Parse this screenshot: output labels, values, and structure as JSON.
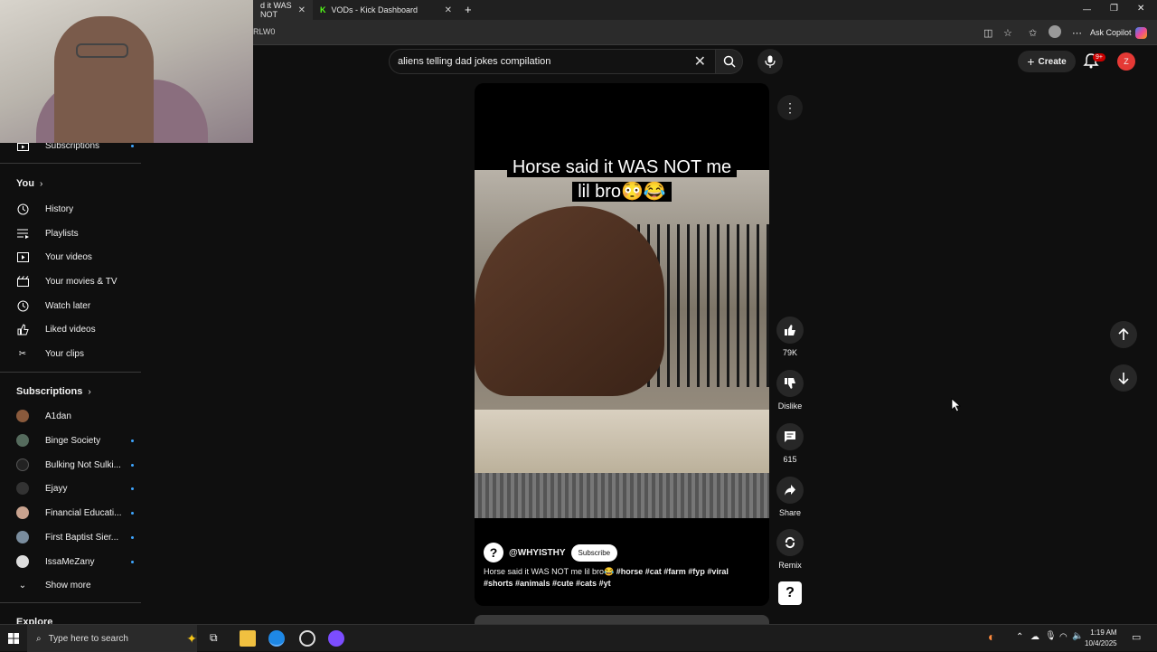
{
  "browser": {
    "tabs": [
      {
        "label": "d it WAS NOT",
        "close": "✕"
      },
      {
        "label": "VODs - Kick Dashboard",
        "close": "✕"
      }
    ],
    "new_tab": "+",
    "address_fragment": "RLW0",
    "ask_copilot": "Ask Copilot",
    "window_controls": [
      "—",
      "❐",
      "✕"
    ]
  },
  "header": {
    "search_value": "aliens telling dad jokes compilation",
    "create_label": "Create",
    "notif_badge": "9+",
    "avatar_letter": "Z"
  },
  "sidebar": {
    "top_item": "Subscriptions",
    "you_label": "You",
    "you_items": [
      {
        "label": "History",
        "icon": "history-icon"
      },
      {
        "label": "Playlists",
        "icon": "playlists-icon"
      },
      {
        "label": "Your videos",
        "icon": "your-videos-icon"
      },
      {
        "label": "Your movies & TV",
        "icon": "movies-icon"
      },
      {
        "label": "Watch later",
        "icon": "watch-later-icon"
      },
      {
        "label": "Liked videos",
        "icon": "liked-icon"
      },
      {
        "label": "Your clips",
        "icon": "clips-icon"
      }
    ],
    "subs_label": "Subscriptions",
    "channels": [
      {
        "label": "A1dan",
        "color": "#8a5a3c",
        "dot": false
      },
      {
        "label": "Binge Society",
        "color": "#556b5d",
        "dot": true
      },
      {
        "label": "Bulking Not Sulki...",
        "color": "#222222",
        "dot": true
      },
      {
        "label": "Ejayy",
        "color": "#333333",
        "dot": true
      },
      {
        "label": "Financial Educati...",
        "color": "#c9a38f",
        "dot": true
      },
      {
        "label": "First Baptist Sier...",
        "color": "#7a8d9e",
        "dot": true
      },
      {
        "label": "IssaMeZany",
        "color": "#dddddd",
        "dot": true
      }
    ],
    "show_more": "Show more",
    "explore": "Explore"
  },
  "short": {
    "caption_line1": "Horse said it WAS NOT me",
    "caption_line2": "lil bro😳😂",
    "channel_avatar": "?",
    "channel": "@WHYISTHY",
    "subscribe": "Subscribe",
    "desc_text": "Horse said it WAS NOT me lil bro😂",
    "desc_tags_1": "#horse #cat #farm #fyp #viral",
    "desc_tags_2": "#shorts #animals #cute #cats #yt"
  },
  "actions": {
    "likes": "79K",
    "dislike": "Dislike",
    "comments": "615",
    "share": "Share",
    "remix": "Remix"
  },
  "taskbar": {
    "search_placeholder": "Type here to search",
    "time": "1:19 AM",
    "date": "10/4/2025"
  }
}
